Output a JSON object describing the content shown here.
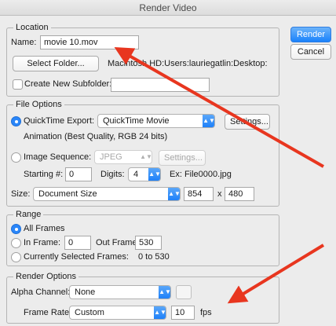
{
  "window": {
    "title": "Render Video"
  },
  "buttons": {
    "render": "Render",
    "cancel": "Cancel"
  },
  "location": {
    "legend": "Location",
    "name_label": "Name:",
    "name_value": "movie 10.mov",
    "select_folder": "Select Folder...",
    "folder_path": "Macintosh HD:Users:lauriegatlin:Desktop:",
    "create_subfolder": "Create New Subfolder:",
    "subfolder_value": ""
  },
  "file_options": {
    "legend": "File Options",
    "quicktime_label": "QuickTime Export:",
    "quicktime_format": "QuickTime Movie",
    "settings": "Settings...",
    "codec_info": "Animation (Best Quality, RGB 24 bits)",
    "image_sequence_label": "Image Sequence:",
    "image_format": "JPEG",
    "image_settings": "Settings...",
    "starting_label": "Starting #:",
    "starting_value": "0",
    "digits_label": "Digits:",
    "digits_value": "4",
    "example": "Ex: File0000.jpg",
    "size_label": "Size:",
    "size_value": "Document Size",
    "width": "854",
    "x_label": "x",
    "height": "480"
  },
  "range": {
    "legend": "Range",
    "all_frames": "All Frames",
    "in_frame_label": "In Frame:",
    "in_frame_value": "0",
    "out_frame_label": "Out Frame:",
    "out_frame_value": "530",
    "selected_frames": "Currently Selected Frames:",
    "selected_range": "0 to 530"
  },
  "render_options": {
    "legend": "Render Options",
    "alpha_label": "Alpha Channel:",
    "alpha_value": "None",
    "frame_rate_label": "Frame Rate:",
    "frame_rate_mode": "Custom",
    "frame_rate_value": "10",
    "fps_label": "fps"
  },
  "colors": {
    "accent": "#1a82fb",
    "annotation_arrow": "#e8361f"
  },
  "icons": {
    "select_arrow": "chevron-up-down-icon"
  }
}
